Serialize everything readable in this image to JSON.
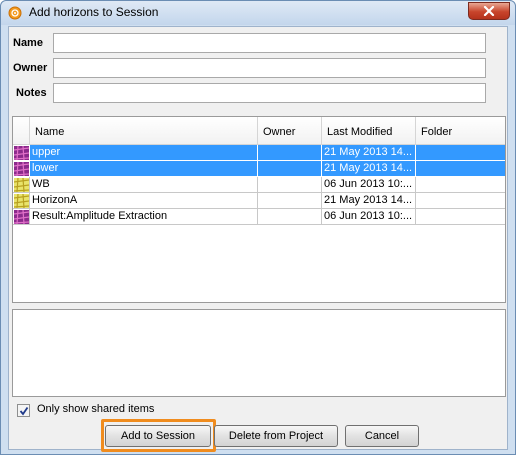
{
  "dialog": {
    "title": "Add horizons to Session"
  },
  "form": {
    "name_label": "Name",
    "name_value": "",
    "owner_label": "Owner",
    "owner_value": "",
    "notes_label": "Notes",
    "notes_value": ""
  },
  "table": {
    "columns": [
      "Name",
      "Owner",
      "Last Modified",
      "Folder"
    ],
    "rows": [
      {
        "name": "upper",
        "owner": "",
        "modified": "21 May 2013 14...",
        "folder": "",
        "selected": true,
        "icon": "horizon-purple-icon"
      },
      {
        "name": "lower",
        "owner": "",
        "modified": "21 May 2013 14...",
        "folder": "",
        "selected": true,
        "icon": "horizon-purple-icon"
      },
      {
        "name": "WB",
        "owner": "",
        "modified": "06 Jun 2013 10:...",
        "folder": "",
        "selected": false,
        "icon": "horizon-yellow-icon"
      },
      {
        "name": "HorizonA",
        "owner": "",
        "modified": "21 May 2013 14...",
        "folder": "",
        "selected": false,
        "icon": "horizon-yellow-icon"
      },
      {
        "name": "Result:Amplitude Extraction",
        "owner": "",
        "modified": "06 Jun 2013 10:...",
        "folder": "",
        "selected": false,
        "icon": "horizon-purple-icon"
      }
    ]
  },
  "options": {
    "shared_only_label": "Only show shared items",
    "shared_only_checked": true
  },
  "buttons": {
    "add_label": "Add to Session",
    "delete_label": "Delete from Project",
    "cancel_label": "Cancel"
  },
  "colors": {
    "selection": "#3399ff",
    "highlight_outline": "#f08c1e",
    "icon_purple": "#8b2a8b",
    "icon_yellow": "#e8e36a"
  }
}
